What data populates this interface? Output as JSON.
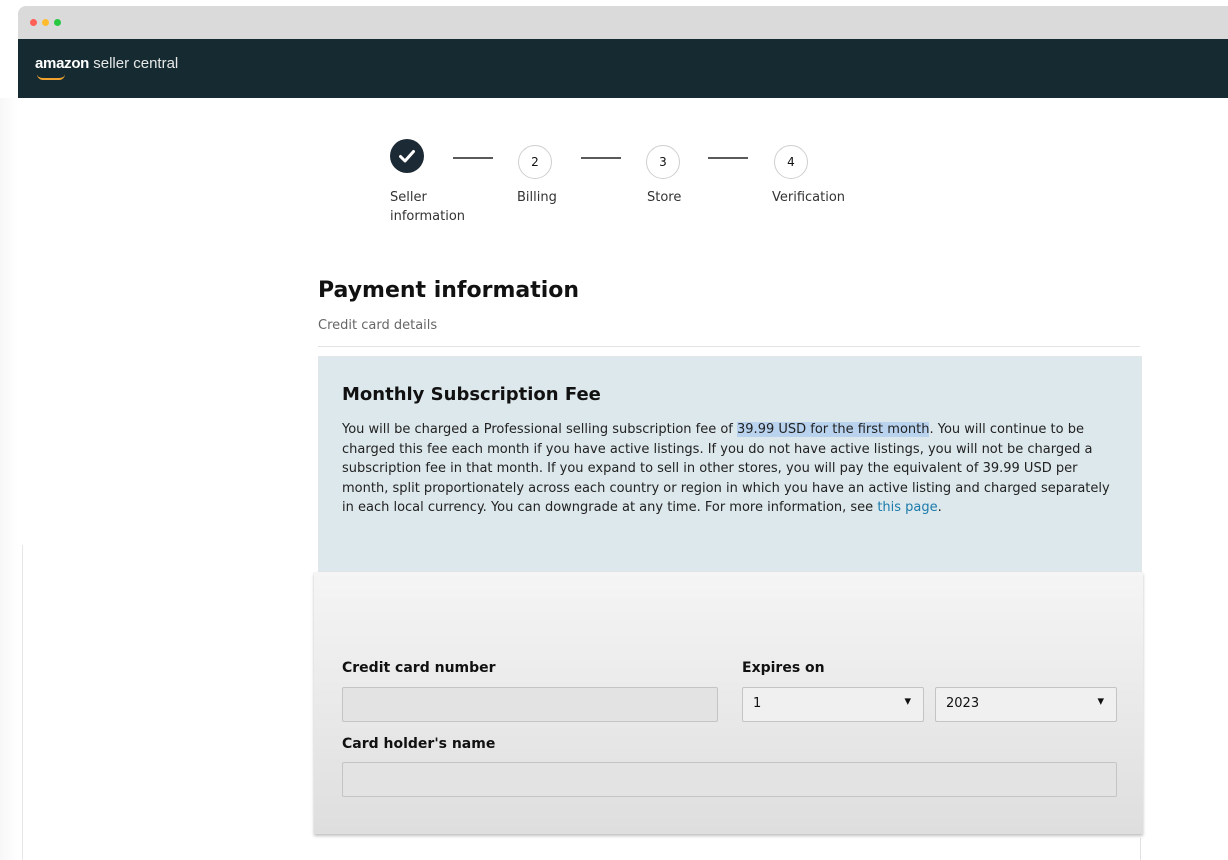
{
  "brand": {
    "name_bold": "amazon",
    "name_rest": " seller central",
    "accent": "#f0a32f",
    "header_bg": "#152b31"
  },
  "stepper": {
    "steps": [
      {
        "number": "",
        "label_line1": "Seller",
        "label_line2": "information",
        "state": "completed",
        "icon": "checkmark-icon"
      },
      {
        "number": "2",
        "label_line1": "Billing",
        "label_line2": "",
        "state": "pending"
      },
      {
        "number": "3",
        "label_line1": "Store",
        "label_line2": "",
        "state": "pending"
      },
      {
        "number": "4",
        "label_line1": "Verification",
        "label_line2": "",
        "state": "pending"
      }
    ]
  },
  "payment": {
    "title": "Payment information",
    "subtitle": "Credit card details"
  },
  "fee": {
    "title": "Monthly Subscription Fee",
    "text_before": "You will be charged a Professional selling subscription fee of ",
    "text_highlight": "39.99 USD for the first month",
    "text_after": ". You will continue to be charged this fee each month if you have active listings. If you do not have active listings, you will not be charged a subscription fee in that month. If you expand to sell in other stores, you will pay the equivalent of 39.99 USD per month, split proportionately across each country or region in which you have an active listing and charged separately in each local currency. You can downgrade at any time. For more information, see ",
    "link_text": "this page",
    "text_end": ".",
    "box_color": "#dde8ec",
    "link_color": "#1b7bab"
  },
  "form": {
    "card_number_label": "Credit card number",
    "card_number_value": "",
    "expires_label": "Expires on",
    "expiry_month": "1",
    "expiry_year": "2023",
    "holder_label": "Card holder's name",
    "holder_value": ""
  }
}
